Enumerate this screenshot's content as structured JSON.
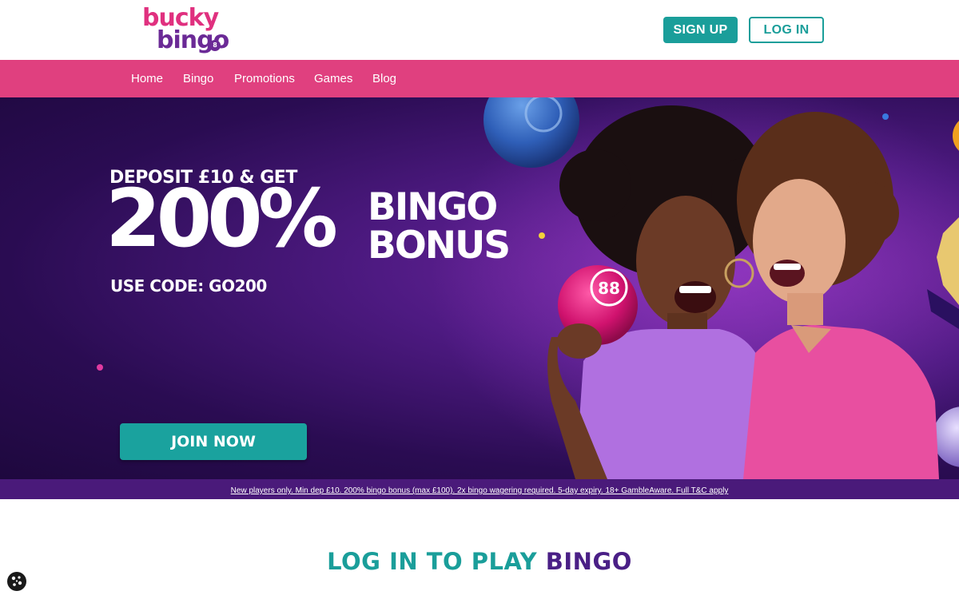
{
  "brand": {
    "logo_top": "bucky",
    "logo_bottom": "bingo",
    "logo_mark": "8"
  },
  "header": {
    "signup_label": "SIGN UP",
    "login_label": "LOG IN"
  },
  "nav": {
    "items": [
      {
        "label": "Home"
      },
      {
        "label": "Bingo"
      },
      {
        "label": "Promotions"
      },
      {
        "label": "Games"
      },
      {
        "label": "Blog"
      }
    ]
  },
  "hero": {
    "line1": "DEPOSIT £10 & GET",
    "big": "200%",
    "word1": "BINGO",
    "word2": "BONUS",
    "code": "USE CODE: GO200",
    "ball_number": "88",
    "cta_label": "JOIN NOW"
  },
  "terms": {
    "text": "New players only. Min dep £10. 200% bingo bonus (max £100). 2x bingo wagering required. 5-day expiry. 18+ GambleAware. Full T&C apply"
  },
  "section": {
    "title_part1": "LOG IN TO PLAY",
    "title_part2": "BINGO"
  },
  "icons": {
    "cookie": "cookie-icon"
  },
  "colors": {
    "teal": "#1a9e9a",
    "pink": "#e0407f",
    "purple_dark": "#4a1a7a",
    "purple_title": "#4a1f86"
  }
}
